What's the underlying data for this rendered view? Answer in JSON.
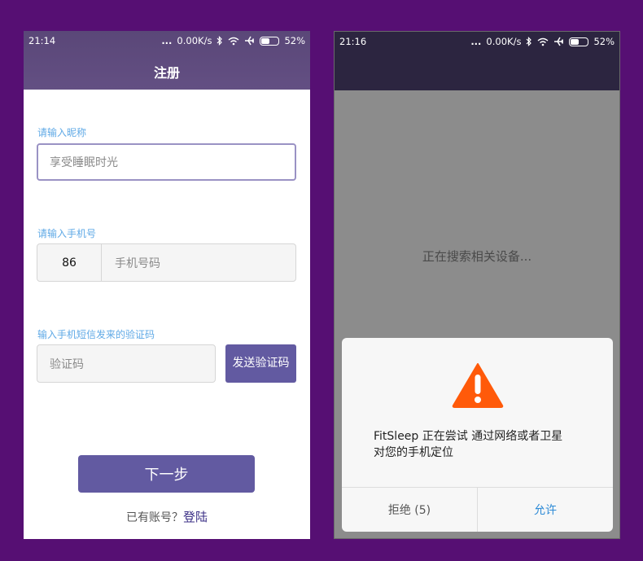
{
  "left_screen": {
    "status": {
      "time": "21:14",
      "dots": "...",
      "speed": "0.00K/s",
      "battery_percent": "52%",
      "battery_level": 0.52
    },
    "title": "注册",
    "nickname": {
      "label": "请输入昵称",
      "value": "享受睡眠时光"
    },
    "phone": {
      "label": "请输入手机号",
      "country_code": "86",
      "placeholder": "手机号码"
    },
    "code": {
      "label": "输入手机短信发来的验证码",
      "placeholder": "验证码",
      "send_button": "发送验证码"
    },
    "next_button": "下一步",
    "login": {
      "prefix": "已有账号？",
      "link": "登陆"
    }
  },
  "right_screen": {
    "status": {
      "time": "21:16",
      "dots": "...",
      "speed": "0.00K/s",
      "battery_percent": "52%",
      "battery_level": 0.52
    },
    "searching_text": "正在搜索相关设备...",
    "dialog": {
      "icon": "warning-icon",
      "message_line1": "FitSleep 正在尝试 通过网络或者卫星",
      "message_line2": "对您的手机定位",
      "deny_label": "拒绝 (5)",
      "allow_label": "允许"
    }
  },
  "colors": {
    "background": "#560f73",
    "header_left": "#5d4a7c",
    "header_right": "#2c2540",
    "accent": "#625aa1",
    "label_blue": "#5fa9e6",
    "warning": "#ff5a0a",
    "allow_blue": "#2d8ad6"
  }
}
